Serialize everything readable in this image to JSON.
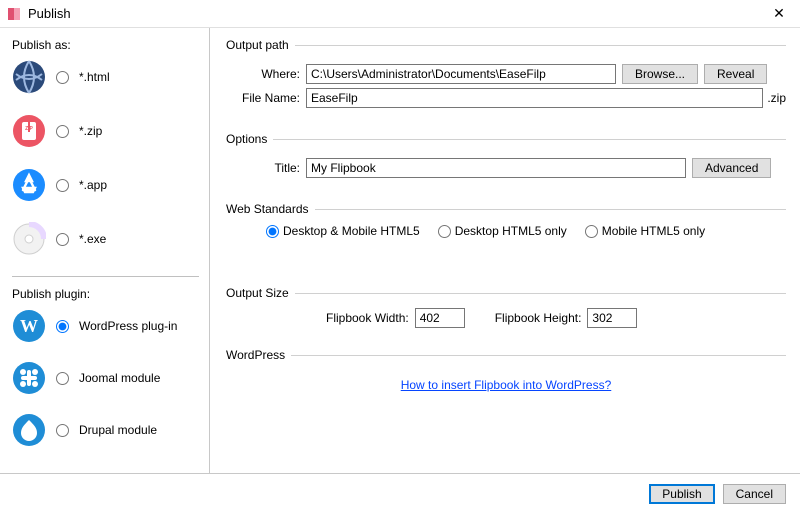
{
  "window": {
    "title": "Publish"
  },
  "sidebar": {
    "publish_as_label": "Publish as:",
    "publish_plugin_label": "Publish plugin:",
    "formats": [
      {
        "label": "*.html",
        "selected": false
      },
      {
        "label": "*.zip",
        "selected": false
      },
      {
        "label": "*.app",
        "selected": false
      },
      {
        "label": "*.exe",
        "selected": false
      }
    ],
    "plugins": [
      {
        "label": "WordPress plug-in",
        "selected": true
      },
      {
        "label": "Joomal module",
        "selected": false
      },
      {
        "label": "Drupal module",
        "selected": false
      }
    ]
  },
  "output_path": {
    "legend": "Output path",
    "where_label": "Where:",
    "where_value": "C:\\Users\\Administrator\\Documents\\EaseFilp",
    "browse_label": "Browse...",
    "reveal_label": "Reveal",
    "filename_label": "File Name:",
    "filename_value": "EaseFilp",
    "filename_suffix": ".zip"
  },
  "options": {
    "legend": "Options",
    "title_label": "Title:",
    "title_value": "My Flipbook",
    "advanced_label": "Advanced"
  },
  "web_standards": {
    "legend": "Web Standards",
    "choices": [
      "Desktop & Mobile HTML5",
      "Desktop HTML5 only",
      "Mobile HTML5 only"
    ],
    "selected_index": 0
  },
  "output_size": {
    "legend": "Output Size",
    "width_label": "Flipbook Width:",
    "width_value": "402",
    "height_label": "Flipbook Height:",
    "height_value": "302"
  },
  "wordpress": {
    "legend": "WordPress",
    "link_text": "How to insert Flipbook into WordPress?"
  },
  "footer": {
    "publish_label": "Publish",
    "cancel_label": "Cancel"
  }
}
